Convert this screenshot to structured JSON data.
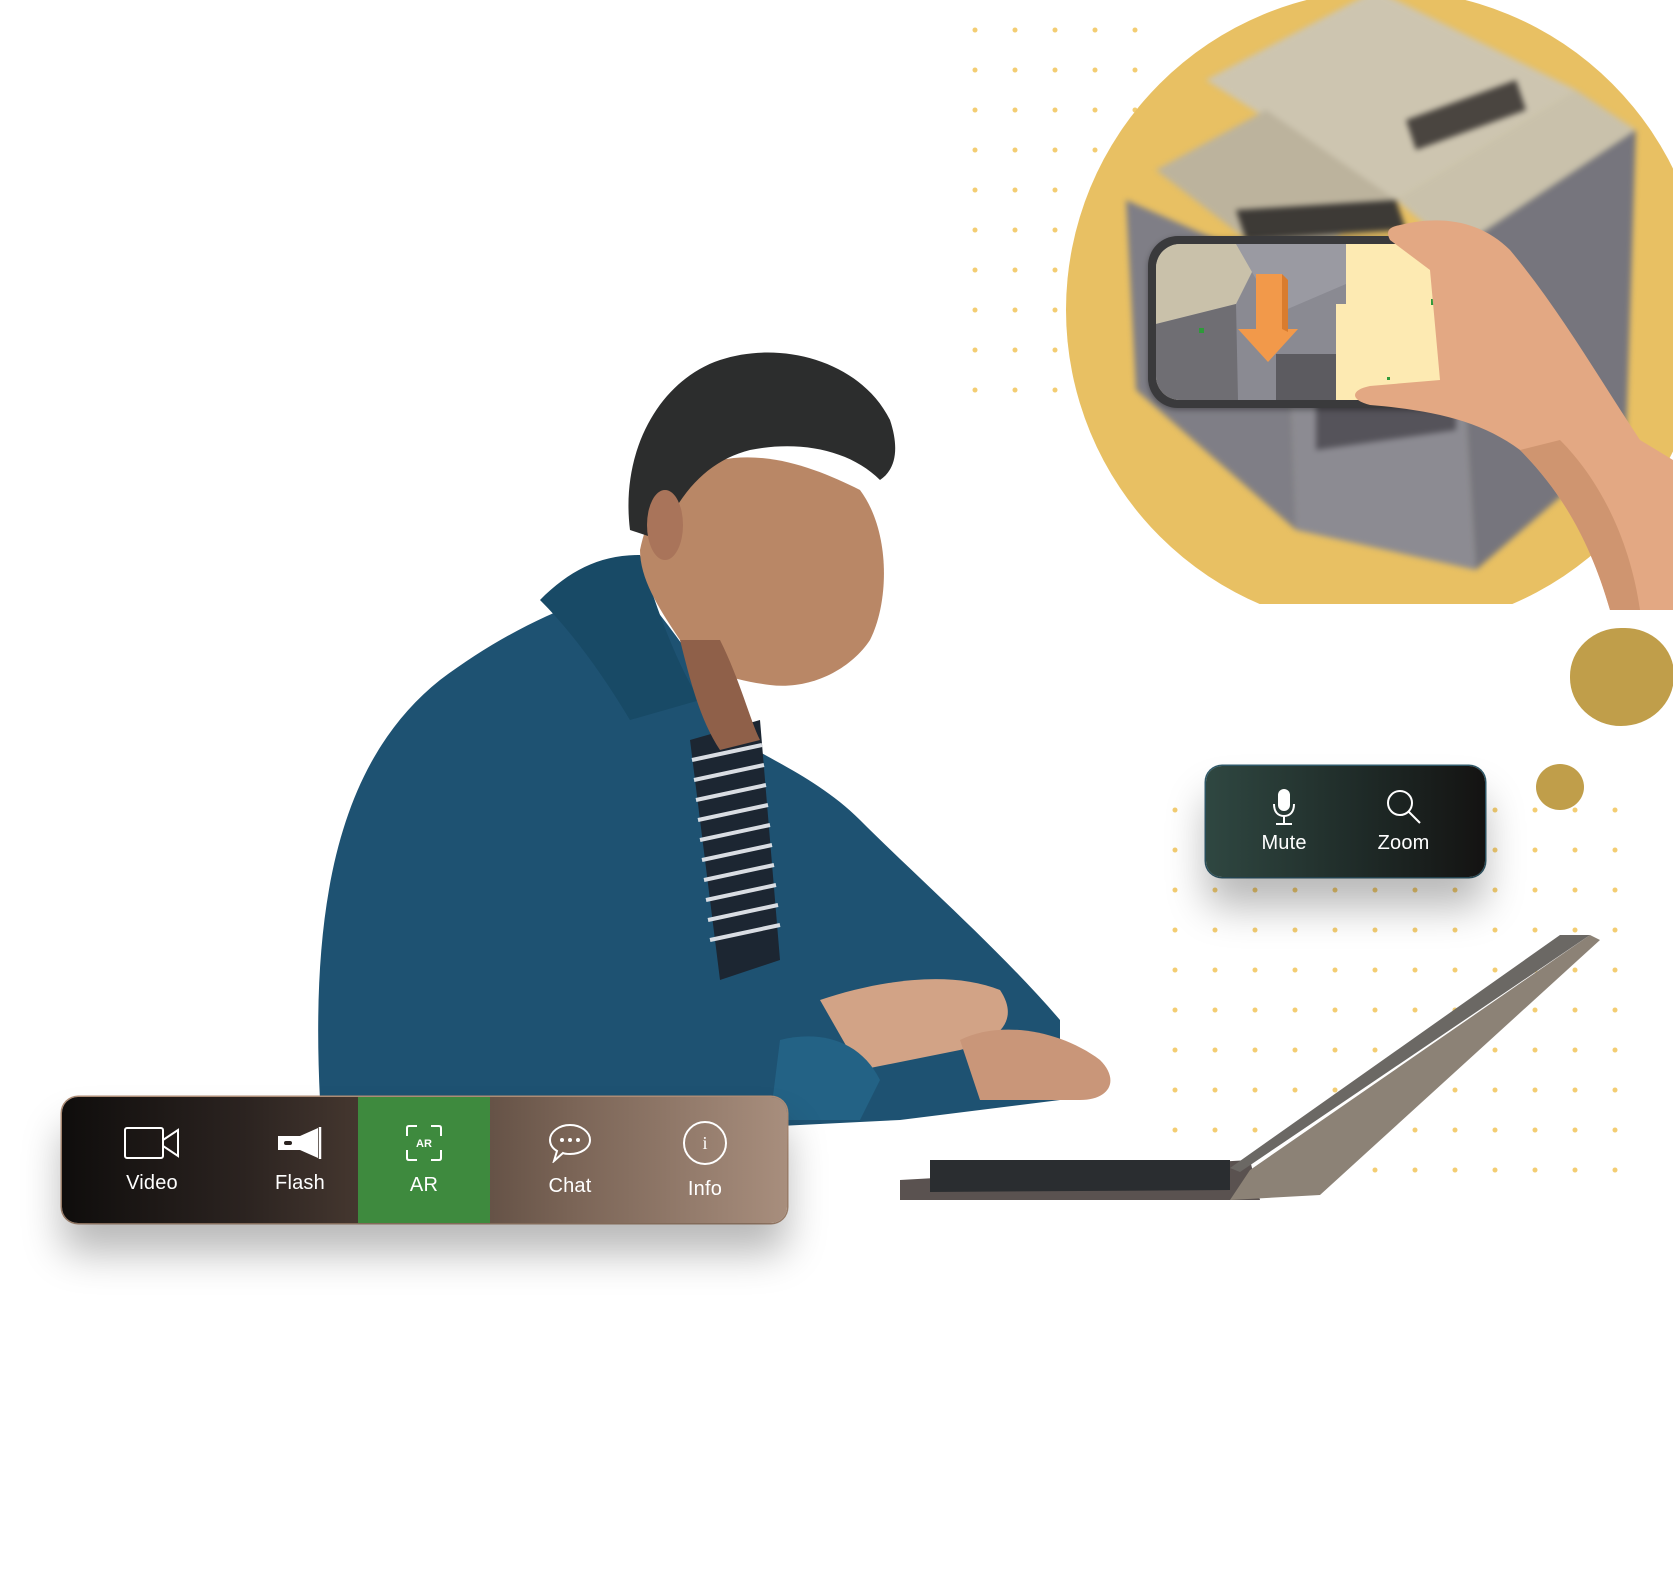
{
  "toolbar": {
    "items": [
      {
        "label": "Video",
        "icon": "video-camera-icon",
        "active": false
      },
      {
        "label": "Flash",
        "icon": "flashlight-icon",
        "active": false
      },
      {
        "label": "AR",
        "icon": "ar-frame-icon",
        "active": true
      },
      {
        "label": "Chat",
        "icon": "chat-bubble-icon",
        "active": false
      },
      {
        "label": "Info",
        "icon": "info-circle-icon",
        "active": false
      }
    ],
    "ar_icon_text": "AR",
    "info_icon_text": "i",
    "active_color": "#3e8a3e"
  },
  "call_controls": {
    "items": [
      {
        "label": "Mute",
        "icon": "microphone-icon"
      },
      {
        "label": "Zoom",
        "icon": "magnifier-icon"
      }
    ]
  },
  "colors": {
    "accent_yellow": "#e8c063",
    "gold_blob": "#c09e4a",
    "dot": "#f3cd72",
    "ar_arrow": "#f2994a"
  }
}
